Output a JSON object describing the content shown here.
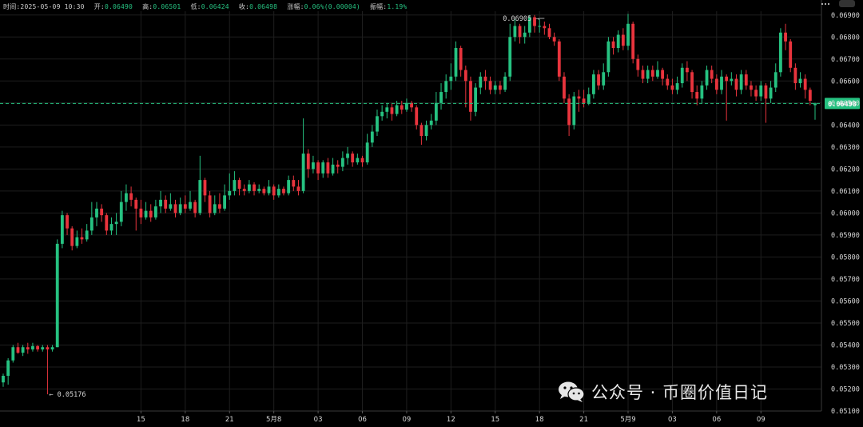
{
  "info": {
    "time_label": "时间:",
    "time_value": "2025-05-09 10:30",
    "open_label": "开:",
    "open_value": "0.06490",
    "high_label": "高:",
    "high_value": "0.06501",
    "low_label": "低:",
    "low_value": "0.06424",
    "close_label": "收:",
    "close_value": "0.06498",
    "change_label": "涨幅:",
    "change_value": "0.06%(0.00004)",
    "amplitude_label": "振幅:",
    "amplitude_value": "1.19%"
  },
  "watermark": {
    "text": "公众号 · 币圈价值日记",
    "icon": "wechat-icon"
  },
  "colors": {
    "up": "#26c281",
    "down": "#e8343d",
    "background": "#000000",
    "grid": "#1e1e1e"
  },
  "chart_data": {
    "type": "candlestick",
    "y_axis": {
      "min": 0.051,
      "max": 0.0691,
      "ticks": [
        "0.06900",
        "0.06800",
        "0.06700",
        "0.06600",
        "0.06500",
        "0.06400",
        "0.06300",
        "0.06200",
        "0.06100",
        "0.06000",
        "0.05900",
        "0.05800",
        "0.05700",
        "0.05600",
        "0.05500",
        "0.05400",
        "0.05300",
        "0.05200",
        "0.05100"
      ]
    },
    "x_axis": {
      "labels": [
        "15",
        "18",
        "21",
        "5月8",
        "03",
        "06",
        "09",
        "12",
        "15",
        "18",
        "21",
        "5月9",
        "03",
        "06",
        "09"
      ],
      "label_positions": [
        28,
        37,
        46,
        55,
        64,
        73,
        82,
        91,
        100,
        109,
        118,
        127,
        136,
        145,
        154
      ]
    },
    "grid": true,
    "last_price": "0.06498",
    "high_marker": {
      "index": 110,
      "text": "0.06905"
    },
    "low_marker": {
      "index": 9,
      "text": "0.05176"
    },
    "candles": [
      [
        0.0523,
        0.0526,
        0.0521,
        0.0527
      ],
      [
        0.0526,
        0.0533,
        0.0522,
        0.0534
      ],
      [
        0.0533,
        0.0539,
        0.0532,
        0.054
      ],
      [
        0.0539,
        0.05365,
        0.0536,
        0.0541
      ],
      [
        0.05365,
        0.0539,
        0.0535,
        0.054
      ],
      [
        0.0539,
        0.0538,
        0.0536,
        0.0541
      ],
      [
        0.0538,
        0.05395,
        0.0537,
        0.0541
      ],
      [
        0.05395,
        0.0538,
        0.0537,
        0.054
      ],
      [
        0.0538,
        0.0539,
        0.0537,
        0.054
      ],
      [
        0.0539,
        0.0538,
        0.05176,
        0.054
      ],
      [
        0.0538,
        0.0539,
        0.0537,
        0.054
      ],
      [
        0.0539,
        0.0586,
        0.0539,
        0.0588
      ],
      [
        0.0586,
        0.0599,
        0.0584,
        0.0601
      ],
      [
        0.0599,
        0.0593,
        0.059,
        0.06
      ],
      [
        0.0593,
        0.0585,
        0.0583,
        0.0594
      ],
      [
        0.0585,
        0.0589,
        0.0584,
        0.0592
      ],
      [
        0.0589,
        0.0588,
        0.0586,
        0.0593
      ],
      [
        0.0588,
        0.0592,
        0.0587,
        0.0595
      ],
      [
        0.0592,
        0.0598,
        0.059,
        0.0605
      ],
      [
        0.0598,
        0.0602,
        0.0594,
        0.0605
      ],
      [
        0.0602,
        0.0599,
        0.0596,
        0.0604
      ],
      [
        0.0599,
        0.0592,
        0.059,
        0.06
      ],
      [
        0.0592,
        0.0595,
        0.059,
        0.0598
      ],
      [
        0.0595,
        0.0596,
        0.059,
        0.06
      ],
      [
        0.0596,
        0.0605,
        0.0594,
        0.061
      ],
      [
        0.0605,
        0.0609,
        0.0601,
        0.0613
      ],
      [
        0.0609,
        0.0606,
        0.0603,
        0.0612
      ],
      [
        0.0606,
        0.0602,
        0.0592,
        0.0607
      ],
      [
        0.0602,
        0.0598,
        0.0595,
        0.0606
      ],
      [
        0.0598,
        0.0601,
        0.0597,
        0.0605
      ],
      [
        0.0601,
        0.0598,
        0.0596,
        0.0604
      ],
      [
        0.0598,
        0.0603,
        0.0597,
        0.0606
      ],
      [
        0.0603,
        0.0606,
        0.06,
        0.061
      ],
      [
        0.0606,
        0.0602,
        0.06,
        0.0608
      ],
      [
        0.0602,
        0.0604,
        0.0601,
        0.0609
      ],
      [
        0.0604,
        0.06,
        0.0598,
        0.0606
      ],
      [
        0.06,
        0.0604,
        0.0599,
        0.0607
      ],
      [
        0.0604,
        0.0602,
        0.06,
        0.0608
      ],
      [
        0.0602,
        0.0605,
        0.0601,
        0.061
      ],
      [
        0.0605,
        0.06,
        0.0598,
        0.0606
      ],
      [
        0.06,
        0.0615,
        0.0599,
        0.0626
      ],
      [
        0.0615,
        0.0608,
        0.0605,
        0.0616
      ],
      [
        0.0608,
        0.06,
        0.0598,
        0.061
      ],
      [
        0.06,
        0.0604,
        0.0599,
        0.0608
      ],
      [
        0.0604,
        0.0602,
        0.06,
        0.0609
      ],
      [
        0.0602,
        0.0608,
        0.0601,
        0.0613
      ],
      [
        0.0608,
        0.061,
        0.0606,
        0.0618
      ],
      [
        0.061,
        0.0615,
        0.0608,
        0.0619
      ],
      [
        0.0615,
        0.0611,
        0.0608,
        0.0616
      ],
      [
        0.0611,
        0.061,
        0.0608,
        0.0613
      ],
      [
        0.061,
        0.0613,
        0.0609,
        0.0615
      ],
      [
        0.0613,
        0.061,
        0.0608,
        0.0614
      ],
      [
        0.061,
        0.0611,
        0.0609,
        0.0613
      ],
      [
        0.0611,
        0.0609,
        0.0608,
        0.0612
      ],
      [
        0.0609,
        0.0612,
        0.0608,
        0.0615
      ],
      [
        0.0612,
        0.0608,
        0.0606,
        0.0613
      ],
      [
        0.0608,
        0.0611,
        0.0607,
        0.0613
      ],
      [
        0.0611,
        0.0609,
        0.0608,
        0.0612
      ],
      [
        0.0609,
        0.0615,
        0.0608,
        0.0617
      ],
      [
        0.0615,
        0.0612,
        0.061,
        0.0617
      ],
      [
        0.0612,
        0.061,
        0.0608,
        0.0615
      ],
      [
        0.061,
        0.0627,
        0.0609,
        0.0643
      ],
      [
        0.0627,
        0.062,
        0.0616,
        0.0629
      ],
      [
        0.062,
        0.0623,
        0.0618,
        0.0626
      ],
      [
        0.0623,
        0.0618,
        0.0615,
        0.0624
      ],
      [
        0.0618,
        0.0623,
        0.0616,
        0.0624
      ],
      [
        0.0623,
        0.0618,
        0.0616,
        0.0625
      ],
      [
        0.0618,
        0.0622,
        0.0617,
        0.0625
      ],
      [
        0.0622,
        0.0621,
        0.0618,
        0.0624
      ],
      [
        0.0621,
        0.0625,
        0.0619,
        0.0628
      ],
      [
        0.0625,
        0.0627,
        0.0622,
        0.063
      ],
      [
        0.0627,
        0.0623,
        0.0621,
        0.0628
      ],
      [
        0.0623,
        0.0625,
        0.0622,
        0.0627
      ],
      [
        0.0625,
        0.0623,
        0.0621,
        0.0626
      ],
      [
        0.0623,
        0.0632,
        0.0622,
        0.0636
      ],
      [
        0.0632,
        0.0637,
        0.063,
        0.064
      ],
      [
        0.0637,
        0.0644,
        0.0635,
        0.0647
      ],
      [
        0.0644,
        0.0646,
        0.0642,
        0.0649
      ],
      [
        0.0646,
        0.0648,
        0.0643,
        0.065
      ],
      [
        0.0648,
        0.0645,
        0.0642,
        0.065
      ],
      [
        0.0645,
        0.0649,
        0.0644,
        0.0651
      ],
      [
        0.0649,
        0.0647,
        0.0645,
        0.0651
      ],
      [
        0.0647,
        0.065,
        0.0646,
        0.0652
      ],
      [
        0.065,
        0.0648,
        0.0646,
        0.0651
      ],
      [
        0.0648,
        0.064,
        0.0638,
        0.0649
      ],
      [
        0.064,
        0.0635,
        0.0631,
        0.0641
      ],
      [
        0.0635,
        0.064,
        0.0633,
        0.0642
      ],
      [
        0.064,
        0.0642,
        0.0638,
        0.0645
      ],
      [
        0.0642,
        0.065,
        0.064,
        0.0655
      ],
      [
        0.065,
        0.0655,
        0.0647,
        0.0659
      ],
      [
        0.0655,
        0.066,
        0.0652,
        0.0663
      ],
      [
        0.066,
        0.0662,
        0.0656,
        0.0668
      ],
      [
        0.0662,
        0.0675,
        0.066,
        0.0678
      ],
      [
        0.0675,
        0.0665,
        0.0662,
        0.0676
      ],
      [
        0.0665,
        0.066,
        0.0648,
        0.0667
      ],
      [
        0.066,
        0.0646,
        0.0642,
        0.0662
      ],
      [
        0.0646,
        0.0657,
        0.0644,
        0.0659
      ],
      [
        0.0657,
        0.0662,
        0.0654,
        0.0664
      ],
      [
        0.0662,
        0.066,
        0.0656,
        0.0665
      ],
      [
        0.066,
        0.0656,
        0.0654,
        0.0662
      ],
      [
        0.0656,
        0.0658,
        0.0654,
        0.066
      ],
      [
        0.0658,
        0.0656,
        0.0654,
        0.066
      ],
      [
        0.0656,
        0.0662,
        0.0655,
        0.0664
      ],
      [
        0.0662,
        0.068,
        0.066,
        0.0686
      ],
      [
        0.068,
        0.0685,
        0.0678,
        0.0688
      ],
      [
        0.0685,
        0.068,
        0.0677,
        0.0686
      ],
      [
        0.068,
        0.0682,
        0.0677,
        0.0685
      ],
      [
        0.0682,
        0.0689,
        0.068,
        0.069
      ],
      [
        0.0689,
        0.0685,
        0.0682,
        0.069
      ],
      [
        0.0685,
        0.0685,
        0.0682,
        0.0688
      ],
      [
        0.0685,
        0.0684,
        0.0681,
        0.0687
      ],
      [
        0.0684,
        0.068,
        0.0679,
        0.0686
      ],
      [
        0.068,
        0.0678,
        0.0676,
        0.0682
      ],
      [
        0.0678,
        0.0662,
        0.066,
        0.0679
      ],
      [
        0.0662,
        0.0652,
        0.065,
        0.0664
      ],
      [
        0.0652,
        0.064,
        0.0635,
        0.0654
      ],
      [
        0.064,
        0.0653,
        0.0638,
        0.0655
      ],
      [
        0.0653,
        0.0652,
        0.0646,
        0.0656
      ],
      [
        0.0652,
        0.065,
        0.0648,
        0.0656
      ],
      [
        0.065,
        0.0654,
        0.0649,
        0.0657
      ],
      [
        0.0654,
        0.0663,
        0.0652,
        0.0665
      ],
      [
        0.0663,
        0.0658,
        0.0656,
        0.0665
      ],
      [
        0.0658,
        0.0664,
        0.0656,
        0.0668
      ],
      [
        0.0664,
        0.0678,
        0.0662,
        0.068
      ],
      [
        0.0678,
        0.0675,
        0.0672,
        0.068
      ],
      [
        0.0675,
        0.0681,
        0.0673,
        0.0683
      ],
      [
        0.0681,
        0.0676,
        0.0674,
        0.0684
      ],
      [
        0.0676,
        0.0686,
        0.0674,
        0.06905
      ],
      [
        0.0686,
        0.067,
        0.0668,
        0.0687
      ],
      [
        0.067,
        0.0665,
        0.0662,
        0.0672
      ],
      [
        0.0665,
        0.0661,
        0.0659,
        0.0667
      ],
      [
        0.0661,
        0.0665,
        0.0659,
        0.0667
      ],
      [
        0.0665,
        0.0662,
        0.066,
        0.0667
      ],
      [
        0.0662,
        0.0665,
        0.0661,
        0.0669
      ],
      [
        0.0665,
        0.0661,
        0.0658,
        0.0666
      ],
      [
        0.0661,
        0.0658,
        0.0656,
        0.0663
      ],
      [
        0.0658,
        0.0656,
        0.0654,
        0.0661
      ],
      [
        0.0656,
        0.0659,
        0.0654,
        0.0662
      ],
      [
        0.0659,
        0.0666,
        0.0657,
        0.0668
      ],
      [
        0.0666,
        0.0664,
        0.066,
        0.0669
      ],
      [
        0.0664,
        0.0655,
        0.0652,
        0.0665
      ],
      [
        0.0655,
        0.0652,
        0.0649,
        0.0658
      ],
      [
        0.0652,
        0.0658,
        0.065,
        0.066
      ],
      [
        0.0658,
        0.0665,
        0.0656,
        0.0667
      ],
      [
        0.0665,
        0.0661,
        0.0659,
        0.0667
      ],
      [
        0.0661,
        0.0656,
        0.0654,
        0.0663
      ],
      [
        0.0656,
        0.0662,
        0.0654,
        0.0665
      ],
      [
        0.0662,
        0.066,
        0.0642,
        0.0663
      ],
      [
        0.066,
        0.0661,
        0.0658,
        0.0664
      ],
      [
        0.0661,
        0.0656,
        0.0653,
        0.0663
      ],
      [
        0.0656,
        0.0663,
        0.0654,
        0.0665
      ],
      [
        0.0663,
        0.0658,
        0.0656,
        0.0665
      ],
      [
        0.0658,
        0.0656,
        0.0653,
        0.066
      ],
      [
        0.0656,
        0.0653,
        0.0651,
        0.0658
      ],
      [
        0.0653,
        0.0658,
        0.0651,
        0.066
      ],
      [
        0.0658,
        0.0652,
        0.0641,
        0.0659
      ],
      [
        0.0652,
        0.0657,
        0.065,
        0.066
      ],
      [
        0.0657,
        0.0664,
        0.0655,
        0.0668
      ],
      [
        0.0664,
        0.0682,
        0.0662,
        0.0684
      ],
      [
        0.0682,
        0.0678,
        0.0674,
        0.0686
      ],
      [
        0.0678,
        0.0666,
        0.0664,
        0.0679
      ],
      [
        0.0666,
        0.0659,
        0.0656,
        0.0668
      ],
      [
        0.0659,
        0.0661,
        0.0657,
        0.0664
      ],
      [
        0.0661,
        0.0656,
        0.0652,
        0.0663
      ],
      [
        0.0656,
        0.0651,
        0.0649,
        0.0657
      ],
      [
        0.0649,
        0.06498,
        0.06424,
        0.06501
      ]
    ]
  }
}
